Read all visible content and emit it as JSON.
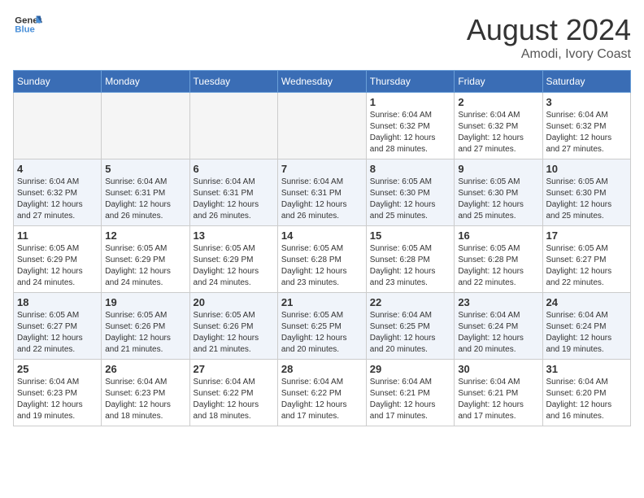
{
  "header": {
    "logo_line1": "General",
    "logo_line2": "Blue",
    "month_year": "August 2024",
    "location": "Amodi, Ivory Coast"
  },
  "weekdays": [
    "Sunday",
    "Monday",
    "Tuesday",
    "Wednesday",
    "Thursday",
    "Friday",
    "Saturday"
  ],
  "weeks": [
    [
      {
        "day": "",
        "info": ""
      },
      {
        "day": "",
        "info": ""
      },
      {
        "day": "",
        "info": ""
      },
      {
        "day": "",
        "info": ""
      },
      {
        "day": "1",
        "info": "Sunrise: 6:04 AM\nSunset: 6:32 PM\nDaylight: 12 hours\nand 28 minutes."
      },
      {
        "day": "2",
        "info": "Sunrise: 6:04 AM\nSunset: 6:32 PM\nDaylight: 12 hours\nand 27 minutes."
      },
      {
        "day": "3",
        "info": "Sunrise: 6:04 AM\nSunset: 6:32 PM\nDaylight: 12 hours\nand 27 minutes."
      }
    ],
    [
      {
        "day": "4",
        "info": "Sunrise: 6:04 AM\nSunset: 6:32 PM\nDaylight: 12 hours\nand 27 minutes."
      },
      {
        "day": "5",
        "info": "Sunrise: 6:04 AM\nSunset: 6:31 PM\nDaylight: 12 hours\nand 26 minutes."
      },
      {
        "day": "6",
        "info": "Sunrise: 6:04 AM\nSunset: 6:31 PM\nDaylight: 12 hours\nand 26 minutes."
      },
      {
        "day": "7",
        "info": "Sunrise: 6:04 AM\nSunset: 6:31 PM\nDaylight: 12 hours\nand 26 minutes."
      },
      {
        "day": "8",
        "info": "Sunrise: 6:05 AM\nSunset: 6:30 PM\nDaylight: 12 hours\nand 25 minutes."
      },
      {
        "day": "9",
        "info": "Sunrise: 6:05 AM\nSunset: 6:30 PM\nDaylight: 12 hours\nand 25 minutes."
      },
      {
        "day": "10",
        "info": "Sunrise: 6:05 AM\nSunset: 6:30 PM\nDaylight: 12 hours\nand 25 minutes."
      }
    ],
    [
      {
        "day": "11",
        "info": "Sunrise: 6:05 AM\nSunset: 6:29 PM\nDaylight: 12 hours\nand 24 minutes."
      },
      {
        "day": "12",
        "info": "Sunrise: 6:05 AM\nSunset: 6:29 PM\nDaylight: 12 hours\nand 24 minutes."
      },
      {
        "day": "13",
        "info": "Sunrise: 6:05 AM\nSunset: 6:29 PM\nDaylight: 12 hours\nand 24 minutes."
      },
      {
        "day": "14",
        "info": "Sunrise: 6:05 AM\nSunset: 6:28 PM\nDaylight: 12 hours\nand 23 minutes."
      },
      {
        "day": "15",
        "info": "Sunrise: 6:05 AM\nSunset: 6:28 PM\nDaylight: 12 hours\nand 23 minutes."
      },
      {
        "day": "16",
        "info": "Sunrise: 6:05 AM\nSunset: 6:28 PM\nDaylight: 12 hours\nand 22 minutes."
      },
      {
        "day": "17",
        "info": "Sunrise: 6:05 AM\nSunset: 6:27 PM\nDaylight: 12 hours\nand 22 minutes."
      }
    ],
    [
      {
        "day": "18",
        "info": "Sunrise: 6:05 AM\nSunset: 6:27 PM\nDaylight: 12 hours\nand 22 minutes."
      },
      {
        "day": "19",
        "info": "Sunrise: 6:05 AM\nSunset: 6:26 PM\nDaylight: 12 hours\nand 21 minutes."
      },
      {
        "day": "20",
        "info": "Sunrise: 6:05 AM\nSunset: 6:26 PM\nDaylight: 12 hours\nand 21 minutes."
      },
      {
        "day": "21",
        "info": "Sunrise: 6:05 AM\nSunset: 6:25 PM\nDaylight: 12 hours\nand 20 minutes."
      },
      {
        "day": "22",
        "info": "Sunrise: 6:04 AM\nSunset: 6:25 PM\nDaylight: 12 hours\nand 20 minutes."
      },
      {
        "day": "23",
        "info": "Sunrise: 6:04 AM\nSunset: 6:24 PM\nDaylight: 12 hours\nand 20 minutes."
      },
      {
        "day": "24",
        "info": "Sunrise: 6:04 AM\nSunset: 6:24 PM\nDaylight: 12 hours\nand 19 minutes."
      }
    ],
    [
      {
        "day": "25",
        "info": "Sunrise: 6:04 AM\nSunset: 6:23 PM\nDaylight: 12 hours\nand 19 minutes."
      },
      {
        "day": "26",
        "info": "Sunrise: 6:04 AM\nSunset: 6:23 PM\nDaylight: 12 hours\nand 18 minutes."
      },
      {
        "day": "27",
        "info": "Sunrise: 6:04 AM\nSunset: 6:22 PM\nDaylight: 12 hours\nand 18 minutes."
      },
      {
        "day": "28",
        "info": "Sunrise: 6:04 AM\nSunset: 6:22 PM\nDaylight: 12 hours\nand 17 minutes."
      },
      {
        "day": "29",
        "info": "Sunrise: 6:04 AM\nSunset: 6:21 PM\nDaylight: 12 hours\nand 17 minutes."
      },
      {
        "day": "30",
        "info": "Sunrise: 6:04 AM\nSunset: 6:21 PM\nDaylight: 12 hours\nand 17 minutes."
      },
      {
        "day": "31",
        "info": "Sunrise: 6:04 AM\nSunset: 6:20 PM\nDaylight: 12 hours\nand 16 minutes."
      }
    ]
  ]
}
